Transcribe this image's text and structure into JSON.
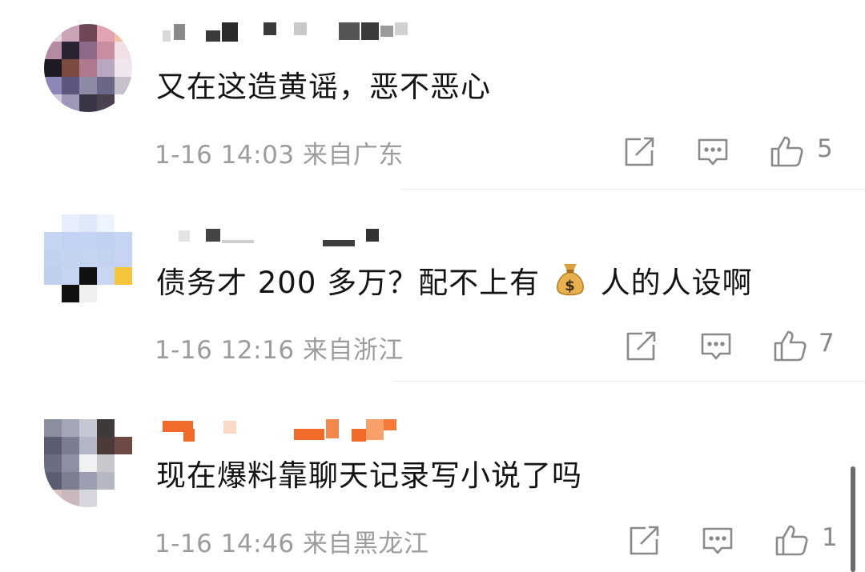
{
  "comments": [
    {
      "text": "又在这造黄谣，恶不恶心",
      "time": "1-16 14:03",
      "location": "来自广东",
      "likes": "5"
    },
    {
      "text_before_emoji": "债务才 200 多万？配不上有",
      "emoji": "money-bag",
      "text_after_emoji": "人的人设啊",
      "time": "1-16 12:16",
      "location": "来自浙江",
      "likes": "7"
    },
    {
      "text": "现在爆料靠聊天记录写小说了吗",
      "time": "1-16 14:46",
      "location": "来自黑龙江",
      "likes": "1"
    }
  ],
  "icons": {
    "share": "share-icon",
    "reply": "comment-icon",
    "like": "thumbs-up-icon"
  },
  "colors": {
    "text": "#141414",
    "meta": "#9c9c9c",
    "icon": "#8a8a8a",
    "divider": "#ececec",
    "username_orange": "#f26a2a"
  }
}
